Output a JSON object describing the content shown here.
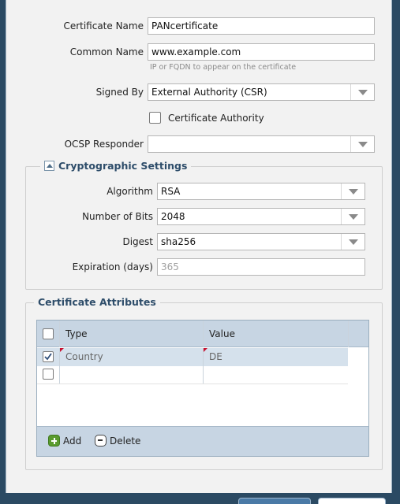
{
  "form": {
    "certificate_name": {
      "label": "Certificate Name",
      "value": "PANcertificate"
    },
    "common_name": {
      "label": "Common Name",
      "value": "www.example.com",
      "hint": "IP or FQDN to appear on the certificate"
    },
    "signed_by": {
      "label": "Signed By",
      "value": "External Authority (CSR)"
    },
    "certificate_authority": {
      "label": "Certificate Authority",
      "checked": false
    },
    "ocsp_responder": {
      "label": "OCSP Responder",
      "value": ""
    }
  },
  "crypto": {
    "title": "Cryptographic Settings",
    "algorithm": {
      "label": "Algorithm",
      "value": "RSA"
    },
    "bits": {
      "label": "Number of Bits",
      "value": "2048"
    },
    "digest": {
      "label": "Digest",
      "value": "sha256"
    },
    "expiration": {
      "label": "Expiration (days)",
      "value": "365"
    }
  },
  "attributes": {
    "title": "Certificate Attributes",
    "columns": [
      "Type",
      "Value"
    ],
    "rows": [
      {
        "type": "Country",
        "value": "DE",
        "checked": true
      },
      {
        "type": "",
        "value": "",
        "checked": false
      }
    ],
    "add_label": "Add",
    "delete_label": "Delete"
  },
  "colors": {
    "accent": "#2e4d6a",
    "header_bg": "#c7d5e3",
    "selected_row": "#d5e1ec"
  }
}
